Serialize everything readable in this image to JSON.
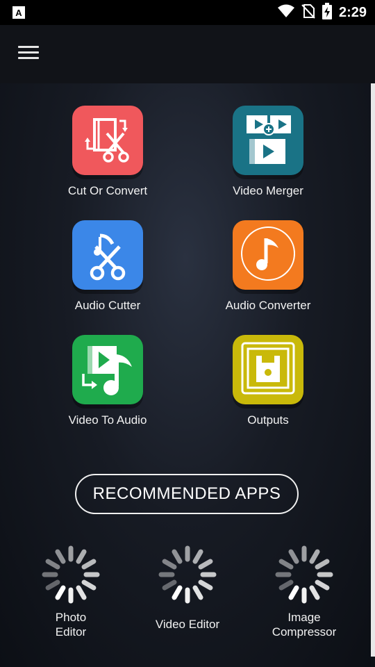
{
  "status_bar": {
    "time": "2:29",
    "icons": [
      "notification-a-icon",
      "wifi-icon",
      "no-sim-icon",
      "battery-charging-icon"
    ]
  },
  "app_bar": {
    "menu_icon": "hamburger-menu-icon"
  },
  "tiles": [
    {
      "label": "Cut Or Convert",
      "color": "#f0585c",
      "icon": "video-scissors-icon"
    },
    {
      "label": "Video Merger",
      "color": "#1a7386",
      "icon": "video-merge-icon"
    },
    {
      "label": "Audio Cutter",
      "color": "#3b87e8",
      "icon": "music-scissors-icon"
    },
    {
      "label": "Audio Converter",
      "color": "#f37a1f",
      "icon": "music-note-circle-icon"
    },
    {
      "label": "Video To Audio",
      "color": "#1fab4d",
      "icon": "video-to-music-icon"
    },
    {
      "label": "Outputs",
      "color": "#c9b90a",
      "icon": "floppy-disk-icon"
    }
  ],
  "recommended": {
    "button_label": "RECOMMENDED APPS",
    "apps": [
      {
        "line1": "Photo",
        "line2": "Editor"
      },
      {
        "line1": "Video Editor",
        "line2": ""
      },
      {
        "line1": "Image",
        "line2": "Compressor"
      }
    ]
  }
}
